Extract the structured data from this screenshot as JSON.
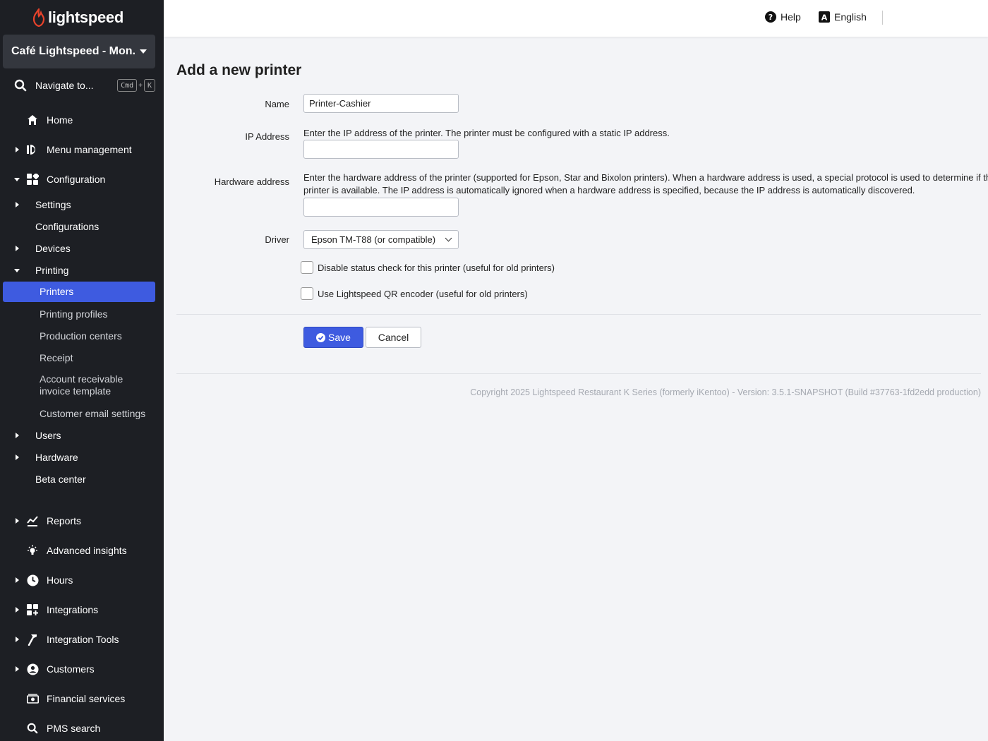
{
  "brand": {
    "name": "lightspeed",
    "accent": "#3e5be0",
    "logo_color": "#e8432b"
  },
  "sidebar": {
    "location": "Café Lightspeed - Mon...",
    "search_label": "Navigate to...",
    "shortcut": {
      "key1": "Cmd",
      "plus": "+",
      "key2": "K"
    },
    "items": {
      "home": "Home",
      "menu_management": "Menu management",
      "configuration": "Configuration",
      "settings": "Settings",
      "configurations": "Configurations",
      "devices": "Devices",
      "printing": "Printing",
      "printers": "Printers",
      "printing_profiles": "Printing profiles",
      "production_centers": "Production centers",
      "receipt": "Receipt",
      "ar_template_line1": "Account receivable",
      "ar_template_line2": "invoice template",
      "customer_email_settings": "Customer email settings",
      "users": "Users",
      "hardware": "Hardware",
      "beta_center": "Beta center",
      "reports": "Reports",
      "advanced_insights": "Advanced insights",
      "hours": "Hours",
      "integrations": "Integrations",
      "integration_tools": "Integration Tools",
      "customers": "Customers",
      "financial_services": "Financial services",
      "pms_search": "PMS search"
    }
  },
  "topbar": {
    "help": "Help",
    "language": "English"
  },
  "form": {
    "title": "Add a new printer",
    "name_label": "Name",
    "name_value": "Printer-Cashier",
    "ip_label": "IP Address",
    "ip_help": "Enter the IP address of the printer. The printer must be configured with a static IP address.",
    "ip_value": "",
    "hw_label": "Hardware address",
    "hw_help_line1": "Enter the hardware address of the printer (supported for Epson, Star and Bixolon printers). When a hardware address is used, a special protocol is used to determine if the",
    "hw_help_line2": "printer is available. The IP address is automatically ignored when a hardware address is specified, because the IP address is automatically discovered.",
    "hw_value": "",
    "driver_label": "Driver",
    "driver_value": "Epson TM-T88 (or compatible)",
    "check_status": "Disable status check for this printer (useful for old printers)",
    "check_qr": "Use Lightspeed QR encoder (useful for old printers)",
    "save": "Save",
    "cancel": "Cancel"
  },
  "footer": {
    "copyright": "Copyright 2025 Lightspeed Restaurant K Series (formerly iKentoo) - Version: 3.5.1-SNAPSHOT (Build #37763-1fd2edd production)"
  }
}
